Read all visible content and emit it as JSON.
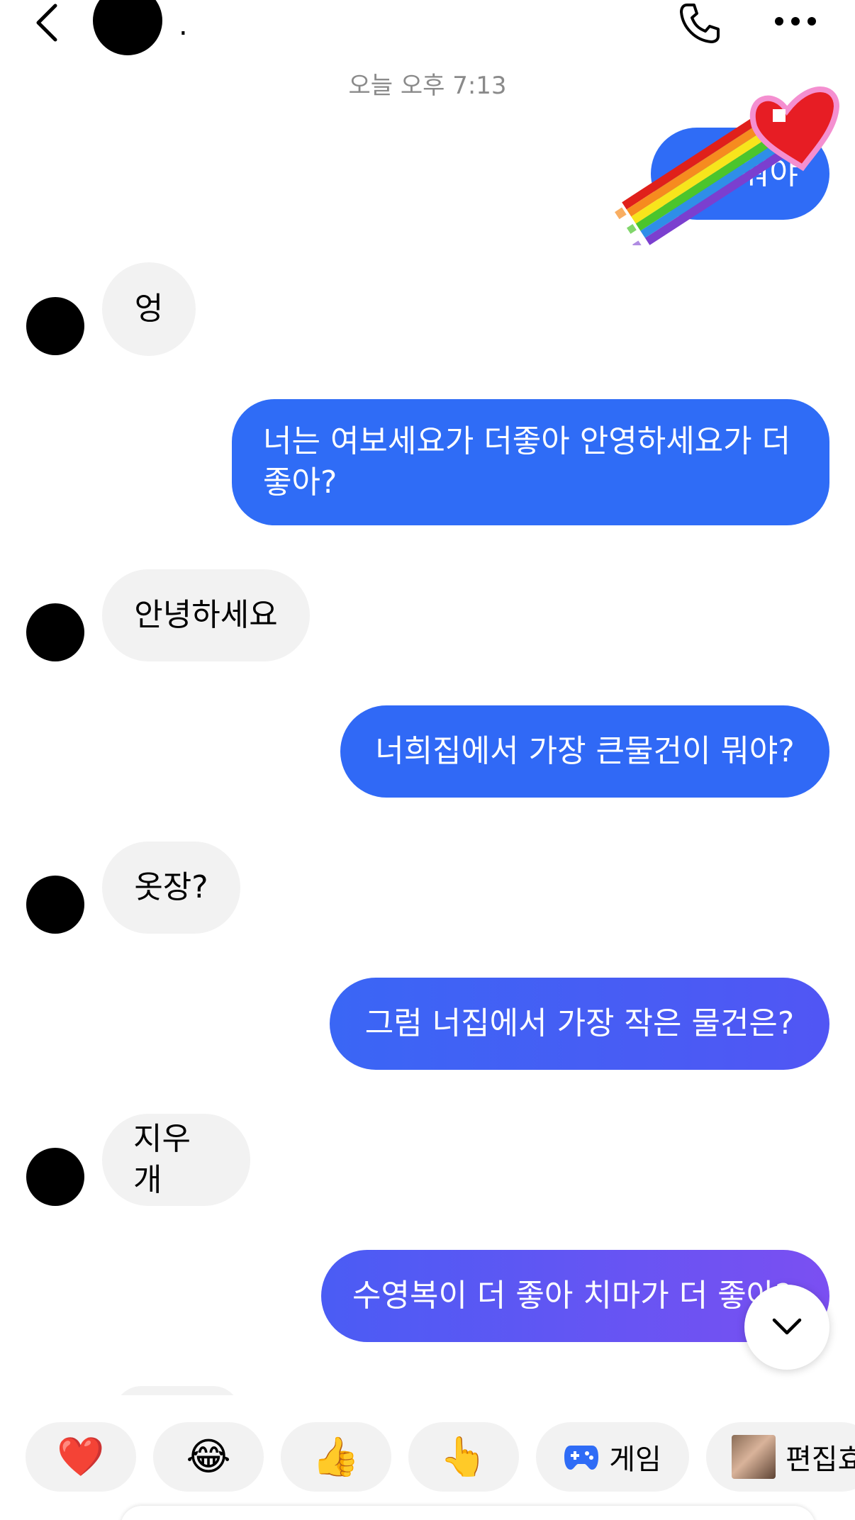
{
  "header": {
    "back_icon": "chevron-left-icon",
    "contact_name": ".",
    "call_icon": "phone-icon",
    "more_icon": "more-horizontal-icon"
  },
  "timestamp": "오늘 오후 7:13",
  "messages": [
    {
      "from": "me",
      "text": "뭐야",
      "note": ""
    },
    {
      "from": "them",
      "text": "엉"
    },
    {
      "from": "me",
      "text": "너는 여보세요가 더좋아 안영하세요가 더 좋아?"
    },
    {
      "from": "them",
      "text": "안녕하세요"
    },
    {
      "from": "me",
      "text": "너희집에서 가장 큰물건이 뭐야?"
    },
    {
      "from": "them",
      "text": "옷장?"
    },
    {
      "from": "me",
      "text": "그럼 너집에서 가장 작은 물건은?"
    },
    {
      "from": "them",
      "text": "지우개"
    },
    {
      "from": "me",
      "text": "수영복이 더 좋아 치마가 더 좋아?"
    }
  ],
  "sticker": {
    "name": "rainbow-heart-sticker"
  },
  "scroll_down_icon": "chevron-down-icon",
  "quick_replies": [
    {
      "emoji": "❤️",
      "icon": "heart-icon"
    },
    {
      "emoji": "😂",
      "icon": "laugh-icon"
    },
    {
      "emoji": "👍",
      "icon": "thumbs-up-icon"
    },
    {
      "emoji": "👆",
      "icon": "point-icon"
    },
    {
      "label": "게임",
      "icon": "game-controller-icon"
    },
    {
      "label": "편집효",
      "icon": "photo-thumbnail"
    }
  ],
  "colors": {
    "bubble_me_start": "#2f6cf6",
    "bubble_me_end": "#7b4ff2",
    "bubble_them": "#f2f2f2",
    "timestamp": "#8a8a8a"
  }
}
